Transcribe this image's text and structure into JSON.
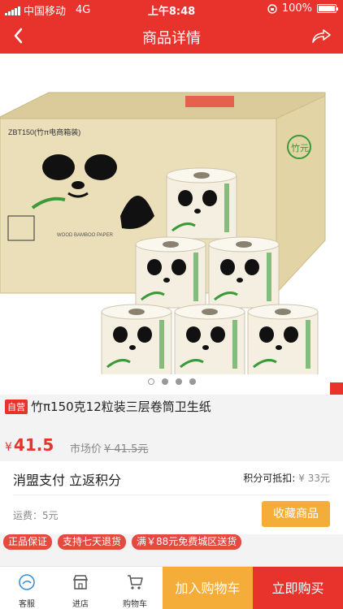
{
  "status_bar": {
    "carrier": "中国移动",
    "network": "4G",
    "time": "上午8:48",
    "battery": "100%"
  },
  "nav": {
    "title": "商品详情"
  },
  "gallery": {
    "packaging": {
      "code": "ZBT150(竹π电商箱装)",
      "brand": "竹元",
      "side_label": "WOOD BAMBOO PAPER"
    },
    "page_count": 4,
    "active_index": 0
  },
  "product": {
    "self_operated_tag": "自营",
    "title": "竹π150克12粒装三层卷筒卫生纸",
    "currency": "¥",
    "price": "41.5",
    "market_label": "市场价",
    "market_price": "¥ 41.5元"
  },
  "promo": {
    "title": "消盟支付 立返积分",
    "points_label": "积分可抵扣:",
    "points_value": "¥ 33元",
    "freight": "运费：5元",
    "favorite_button": "收藏商品"
  },
  "tags": [
    "正品保证",
    "支持七天退货",
    "满￥88元免费城区送货"
  ],
  "tabbar": {
    "service": "客服",
    "store": "进店",
    "cart": "购物车",
    "add_to_cart": "加入购物车",
    "buy_now": "立即购买"
  },
  "colors": {
    "brand_red": "#e8322c",
    "orange": "#f5ad39"
  }
}
